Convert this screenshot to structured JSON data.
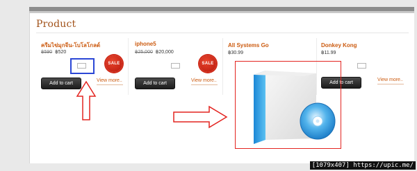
{
  "section": {
    "title": "Product"
  },
  "products": [
    {
      "name": "ครีมไข่มุกจีน-โบโลโกลด์",
      "old_price": "฿590",
      "new_price": "฿520",
      "sale_badge": "SALE",
      "add_label": "Add to cart",
      "view_label": "View more.."
    },
    {
      "name": "iphone5",
      "old_price": "฿25,000",
      "new_price": "฿20,000",
      "sale_badge": "SALE",
      "add_label": "Add to cart",
      "view_label": "View more.."
    },
    {
      "name": "All Systems Go",
      "old_price": "",
      "new_price": "฿30.99"
    },
    {
      "name": "Donkey Kong",
      "old_price": "",
      "new_price": "฿11.99",
      "add_label": "Add to cart",
      "view_label": "View more.."
    }
  ],
  "watermark": "[1079x407] https://upic.me/",
  "colors": {
    "accent": "#cc5b10",
    "annotation_red": "#e3231f",
    "annotation_blue": "#2b47d6",
    "product_box": "#3fa9e6"
  }
}
